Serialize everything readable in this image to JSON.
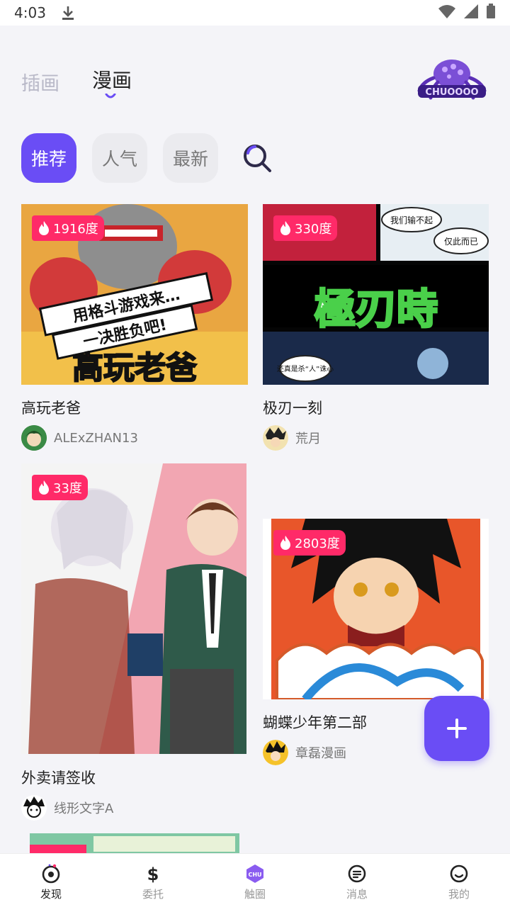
{
  "status_bar": {
    "time": "4:03"
  },
  "header": {
    "tabs": [
      {
        "label": "插画"
      },
      {
        "label": "漫画"
      }
    ],
    "logo_text": "CHUOOOO"
  },
  "filters": [
    {
      "label": "推荐"
    },
    {
      "label": "人气"
    },
    {
      "label": "最新"
    }
  ],
  "cards": [
    {
      "heat": "1916度",
      "title": "高玩老爸",
      "author": "ALExZHAN13",
      "cover_text_top": "用格斗游戏来…",
      "cover_text_mid": "一决胜负吧!",
      "cover_text_big": "高玩老爸"
    },
    {
      "heat": "330度",
      "title": "极刃一刻",
      "author": "荒月",
      "cover_text_big": "極刃時",
      "bubble1": "我们输不起",
      "bubble2": "仅此而已",
      "bubble3": "还真是杀“人”诛心"
    },
    {
      "heat": "33度",
      "title": "外卖请签收",
      "author": "线形文字A"
    },
    {
      "heat": "2803度",
      "title": "蝴蝶少年第二部",
      "author": "章磊漫画"
    },
    {
      "heat": ""
    }
  ],
  "bottom_nav": [
    {
      "label": "发现"
    },
    {
      "label": "委托"
    },
    {
      "label": "触圈",
      "icon_text": "CHU"
    },
    {
      "label": "消息"
    },
    {
      "label": "我的"
    }
  ],
  "colors": {
    "accent": "#6a4df5",
    "heat": "#ff2a68",
    "background": "#f4f4f8"
  }
}
